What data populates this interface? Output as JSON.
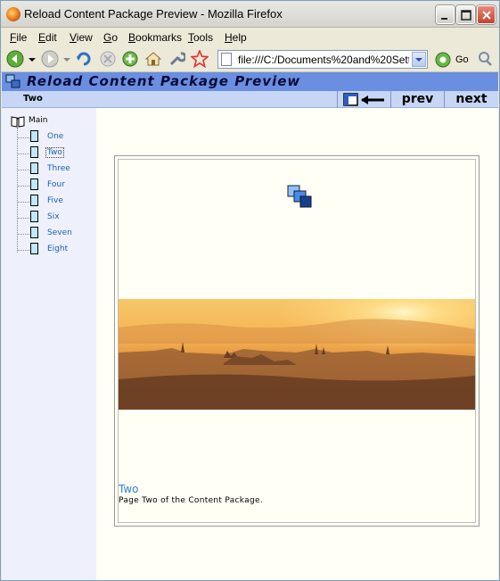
{
  "window": {
    "title": "Reload Content Package Preview - Mozilla Firefox"
  },
  "menu": [
    "File",
    "Edit",
    "View",
    "Go",
    "Bookmarks",
    "Tools",
    "Help"
  ],
  "navbar": {
    "url": "file:///C:/Documents%20and%20Settings",
    "go_label": "Go",
    "icons": [
      "back-icon",
      "forward-icon",
      "reload-icon",
      "stop-icon",
      "new-tab-icon",
      "home-icon",
      "tools-icon",
      "bookmark-star-icon",
      "page-icon",
      "go-icon",
      "search-engine-icon"
    ]
  },
  "reload": {
    "header_title": "Reload Content Package Preview",
    "current_item": "Two",
    "prev_label": "prev",
    "next_label": "next"
  },
  "tree": {
    "root": "Main",
    "items": [
      "One",
      "Two",
      "Three",
      "Four",
      "Five",
      "Six",
      "Seven",
      "Eight"
    ],
    "selected": "Two"
  },
  "content": {
    "title": "Two",
    "description": "Page Two of the Content Package."
  }
}
